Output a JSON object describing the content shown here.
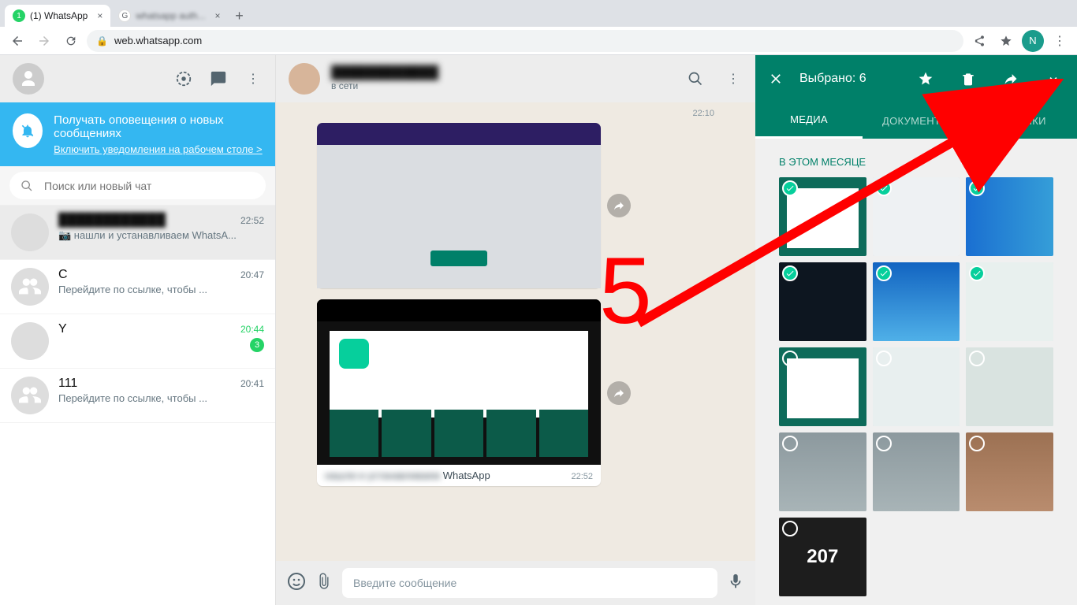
{
  "windows": {
    "min": "—",
    "max": "▢",
    "close": "✕"
  },
  "chrome": {
    "tabs": [
      {
        "label": "(1) WhatsApp",
        "active": true,
        "fav_bg": "#25d366",
        "fav_text": "1"
      },
      {
        "label": "whatsapp auth...",
        "active": false,
        "fav_bg": "#fff",
        "fav_text": "G"
      }
    ],
    "newtab": "+",
    "url": "web.whatsapp.com",
    "profile_initial": "N"
  },
  "sidebar": {
    "notif_title": "Получать оповещения о новых сообщениях",
    "notif_sub": "Включить уведомления на рабочем столе >",
    "search_placeholder": "Поиск или новый чат",
    "chats": [
      {
        "name": "████████████",
        "time": "22:52",
        "msg": "📷 нашли и устанавливаем WhatsA...",
        "active": true
      },
      {
        "name": "С",
        "time": "20:47",
        "msg": "Перейдите по ссылке, чтобы ..."
      },
      {
        "name": "Y",
        "time": "20:44",
        "msg": "",
        "unread": "3",
        "colorful": true
      },
      {
        "name": "111",
        "time": "20:41",
        "msg": "Перейдите по ссылке, чтобы ..."
      }
    ]
  },
  "main": {
    "status": "в сети",
    "time_top": "22:10",
    "caption_prefix": "нашли и устанавливаем",
    "caption_suffix": "WhatsApp",
    "cap_time": "22:52",
    "compose_placeholder": "Введите сообщение"
  },
  "panel": {
    "selected_label": "Выбрано: 6",
    "tabs": {
      "media": "МЕДИА",
      "docs": "ДОКУМЕНТЫ",
      "links": "ССЫЛКИ"
    },
    "section": "В ЭТОМ МЕСЯЦЕ",
    "tile_207": "207"
  },
  "annotation": {
    "five": "5"
  }
}
